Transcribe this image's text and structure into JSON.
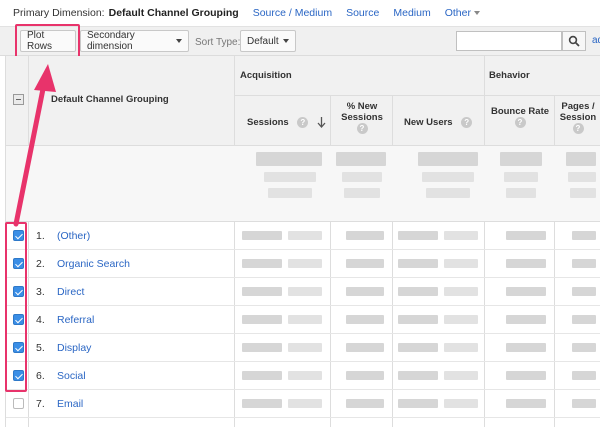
{
  "primary_dimension": {
    "label": "Primary Dimension:",
    "current": "Default Channel Grouping",
    "links": [
      "Source / Medium",
      "Source",
      "Medium"
    ],
    "other": "Other"
  },
  "toolbar": {
    "plot_rows_label": "Plot Rows",
    "secondary_dimension_label": "Secondary dimension",
    "sort_type_label": "Sort Type:",
    "sort_type_value": "Default",
    "search_placeholder": "",
    "advanced_label": "ad"
  },
  "table": {
    "dimension_header": "Default Channel Grouping",
    "groups": {
      "acquisition": "Acquisition",
      "behavior": "Behavior"
    },
    "columns": {
      "sessions": "Sessions",
      "new_sessions_line1": "% New",
      "new_sessions_line2": "Sessions",
      "new_users": "New Users",
      "bounce_rate": "Bounce Rate",
      "pages_line1": "Pages /",
      "pages_line2": "Session"
    },
    "help_icon": "?",
    "rows": [
      {
        "num": "1.",
        "name": "(Other)",
        "checked": true
      },
      {
        "num": "2.",
        "name": "Organic Search",
        "checked": true
      },
      {
        "num": "3.",
        "name": "Direct",
        "checked": true
      },
      {
        "num": "4.",
        "name": "Referral",
        "checked": true
      },
      {
        "num": "5.",
        "name": "Display",
        "checked": true
      },
      {
        "num": "6.",
        "name": "Social",
        "checked": true
      },
      {
        "num": "7.",
        "name": "Email",
        "checked": false
      }
    ]
  },
  "colors": {
    "highlight": "#e8336b",
    "link": "#2a66c4",
    "checkbox_on": "#3a8ee6"
  },
  "icons": [
    "chevron-down-icon",
    "search-icon",
    "help-icon",
    "sort-down-arrow-icon",
    "annotation-arrow"
  ]
}
